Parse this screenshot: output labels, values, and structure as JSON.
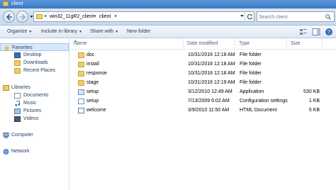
{
  "window": {
    "title": "client"
  },
  "address": {
    "crumbs": [
      "win32_11gR2_client",
      "client"
    ]
  },
  "search": {
    "placeholder": "Search client"
  },
  "toolbar": {
    "organize": "Organize",
    "include_in_library": "Include in library",
    "share_with": "Share with",
    "new_folder": "New folder"
  },
  "nav": {
    "favorites": "Favorites",
    "desktop": "Desktop",
    "downloads": "Downloads",
    "recent_places": "Recent Places",
    "libraries": "Libraries",
    "documents": "Documents",
    "music": "Music",
    "pictures": "Pictures",
    "videos": "Videos",
    "computer": "Computer",
    "network": "Network"
  },
  "columns": {
    "name": "Name",
    "date_modified": "Date modified",
    "type": "Type",
    "size": "Size"
  },
  "files": [
    {
      "name": "doc",
      "date": "10/31/2016 12:18 AM",
      "type": "File folder",
      "size": "",
      "icon": "folder-icon"
    },
    {
      "name": "install",
      "date": "10/31/2016 12:18 AM",
      "type": "File folder",
      "size": "",
      "icon": "folder-icon"
    },
    {
      "name": "response",
      "date": "10/31/2016 12:18 AM",
      "type": "File folder",
      "size": "",
      "icon": "folder-icon"
    },
    {
      "name": "stage",
      "date": "10/31/2016 12:19 AM",
      "type": "File folder",
      "size": "",
      "icon": "folder-icon"
    },
    {
      "name": "setup",
      "date": "3/12/2010 12:49 AM",
      "type": "Application",
      "size": "530 KB",
      "icon": "application-icon"
    },
    {
      "name": "setup",
      "date": "7/13/2009 6:02 AM",
      "type": "Configuration settings",
      "size": "1 KB",
      "icon": "config-file-icon"
    },
    {
      "name": "welcome",
      "date": "3/9/2010 11:50 AM",
      "type": "HTML Document",
      "size": "5 KB",
      "icon": "html-file-icon"
    }
  ],
  "colors": {
    "titlebar": "#3a78c2",
    "folder": "#f1cd63",
    "selection": "#d9e8fb"
  }
}
